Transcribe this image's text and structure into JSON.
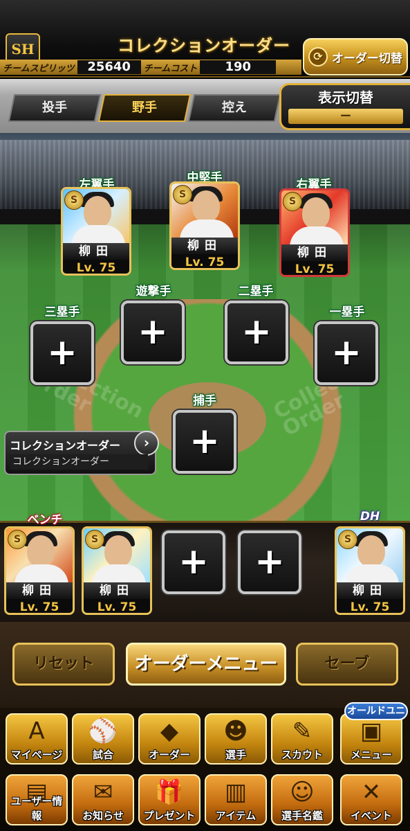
{
  "header": {
    "logo_text": "SH",
    "title": "コレクションオーダー",
    "order_switch_label": "オーダー切替",
    "team_spirit_label": "チームスピリッツ",
    "team_spirit_value": "25640",
    "team_cost_label": "チームコスト",
    "team_cost_value": "190"
  },
  "tabs": [
    {
      "label": "投手",
      "active": false
    },
    {
      "label": "野手",
      "active": true
    },
    {
      "label": "控え",
      "active": false
    }
  ],
  "display_switch": {
    "label": "表示切替",
    "value": "ー"
  },
  "field": {
    "watermark_left": "Collection Order",
    "watermark_right": "Collection Order",
    "outfield": [
      {
        "position": "左翼手",
        "player": "柳田",
        "level": "Lv. 75",
        "badge": "S",
        "border": "gold"
      },
      {
        "position": "中堅手",
        "player": "柳田",
        "level": "Lv. 75",
        "badge": "S",
        "border": "gold"
      },
      {
        "position": "右翼手",
        "player": "柳田",
        "level": "Lv. 75",
        "badge": "S",
        "border": "red"
      }
    ],
    "infield_empty": [
      {
        "position": "遊撃手"
      },
      {
        "position": "二塁手"
      },
      {
        "position": "三塁手"
      },
      {
        "position": "一塁手"
      },
      {
        "position": "捕手"
      }
    ],
    "plus_symbol": "+"
  },
  "collection_panel": {
    "title": "コレクションオーダー",
    "subtitle": "コレクションオーダー",
    "arrow": "›"
  },
  "bench": {
    "bench_label": "ベンチ",
    "dh_label": "DH",
    "cards": [
      {
        "player": "柳田",
        "level": "Lv. 75",
        "badge": "S"
      },
      {
        "player": "柳田",
        "level": "Lv. 75",
        "badge": "S"
      }
    ],
    "dh_card": {
      "player": "柳田",
      "level": "Lv. 75",
      "badge": "S"
    }
  },
  "actions": {
    "reset": "リセット",
    "order_menu": "オーダーメニュー",
    "save": "セーブ"
  },
  "nav_row1": [
    {
      "label": "マイページ",
      "glyph": "A",
      "icon": "mypage-icon"
    },
    {
      "label": "試合",
      "glyph": "⚾",
      "icon": "stadium-icon"
    },
    {
      "label": "オーダー",
      "glyph": "◆",
      "icon": "order-field-icon"
    },
    {
      "label": "選手",
      "glyph": "☻",
      "icon": "player-icon"
    },
    {
      "label": "スカウト",
      "glyph": "✎",
      "icon": "scout-icon"
    },
    {
      "label": "メニュー",
      "glyph": "▣",
      "icon": "menu-icon"
    }
  ],
  "nav_row2": [
    {
      "label": "ユーザー情報",
      "glyph": "▤",
      "icon": "user-info-icon"
    },
    {
      "label": "お知らせ",
      "glyph": "✉",
      "icon": "notice-icon"
    },
    {
      "label": "プレゼント",
      "glyph": "🎁",
      "icon": "present-icon"
    },
    {
      "label": "アイテム",
      "glyph": "▥",
      "icon": "item-icon"
    },
    {
      "label": "選手名鑑",
      "glyph": "☺",
      "icon": "player-book-icon"
    },
    {
      "label": "イベント",
      "glyph": "✕",
      "icon": "event-icon"
    }
  ],
  "old_uni_badge": "オールドユニ"
}
